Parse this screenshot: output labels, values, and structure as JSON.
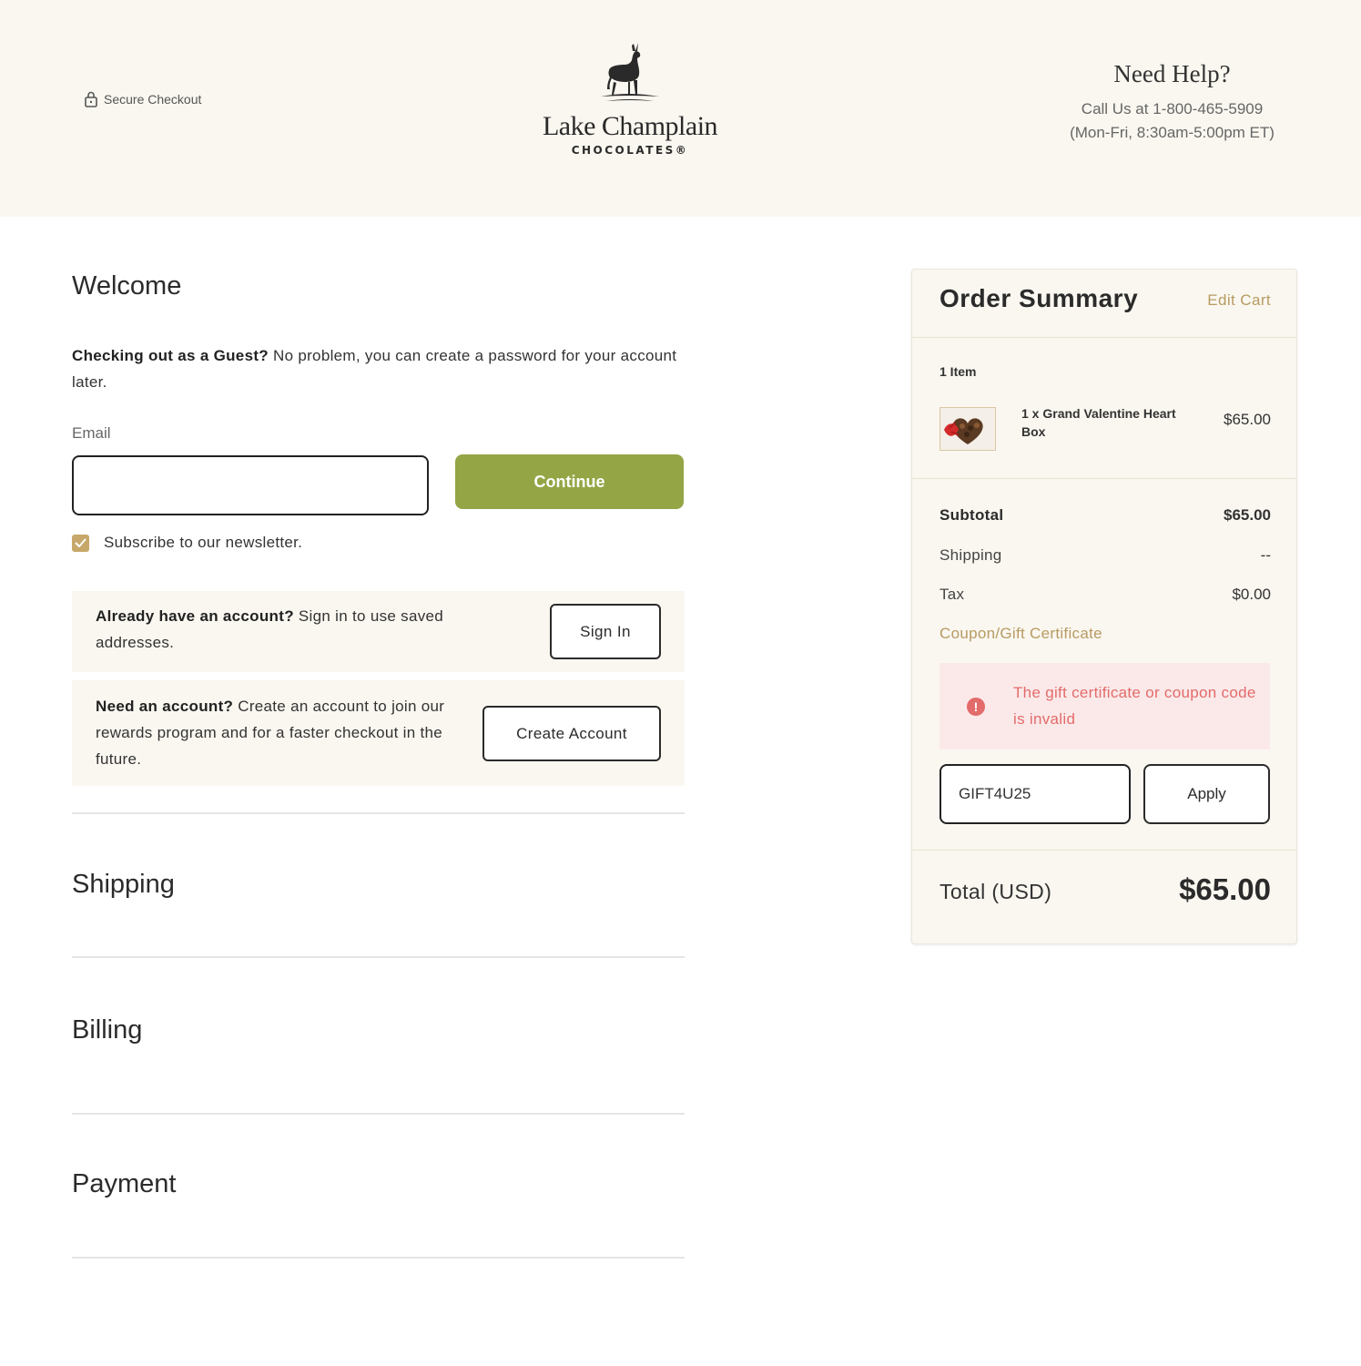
{
  "header": {
    "secure_checkout": "Secure Checkout",
    "brand_name": "Lake Champlain",
    "brand_sub": "CHOCOLATES®",
    "help_title": "Need Help?",
    "help_phone": "Call Us at 1-800-465-5909",
    "help_hours": "(Mon-Fri, 8:30am-5:00pm ET)"
  },
  "welcome": {
    "title": "Welcome",
    "guest_bold": "Checking out as a Guest?",
    "guest_rest": " No problem, you can create a password for your account later.",
    "email_label": "Email",
    "email_value": "",
    "continue_label": "Continue",
    "subscribe_label": "Subscribe to our newsletter.",
    "subscribe_checked": true,
    "signin_bold": "Already have an account?",
    "signin_rest": " Sign in to use saved addresses.",
    "signin_button": "Sign In",
    "create_bold": "Need an account?",
    "create_rest": " Create an account to join our rewards program and for a faster checkout in the future.",
    "create_button": "Create Account"
  },
  "sections": {
    "shipping": "Shipping",
    "billing": "Billing",
    "payment": "Payment"
  },
  "summary": {
    "title": "Order Summary",
    "edit_cart": "Edit Cart",
    "items_count": "1 Item",
    "item_name": "1 x Grand Valentine Heart Box",
    "item_price": "$65.00",
    "subtotal_label": "Subtotal",
    "subtotal_value": "$65.00",
    "shipping_label": "Shipping",
    "shipping_value": "--",
    "tax_label": "Tax",
    "tax_value": "$0.00",
    "coupon_label": "Coupon/Gift Certificate",
    "error_message": "The gift certificate or coupon code is invalid",
    "coupon_value": "GIFT4U25",
    "apply_label": "Apply",
    "total_label": "Total (USD)",
    "total_value": "$65.00"
  },
  "colors": {
    "header_bg": "#faf7f0",
    "accent_green": "#93a545",
    "accent_gold": "#b79b63",
    "error_red": "#e36b6b",
    "error_bg": "#fbe9e9"
  },
  "icons": [
    "lock-icon",
    "deer-logo",
    "check-icon",
    "error-icon",
    "product-thumbnail"
  ]
}
